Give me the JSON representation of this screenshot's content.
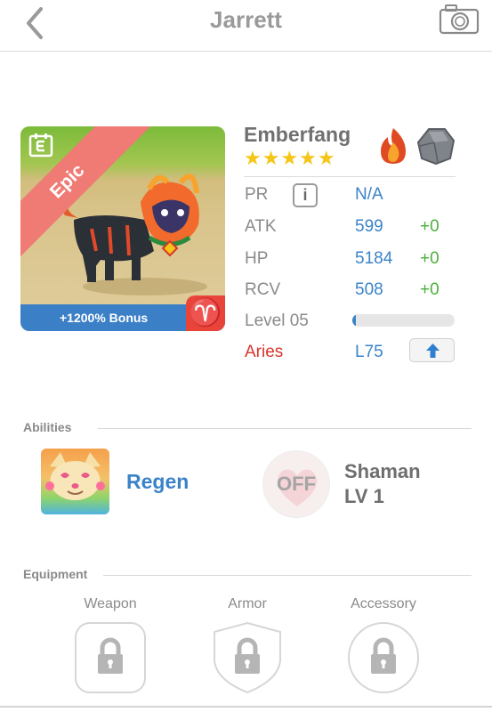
{
  "header": {
    "title": "Jarrett",
    "back_icon": "chevron-left-icon",
    "camera_icon": "camera-icon"
  },
  "card": {
    "rarity": "Epic",
    "bonus": "+1200% Bonus",
    "sign_glyph": "♈",
    "colors": {
      "rarity": "#f07a74",
      "bonus_bar": "#3b7fc7",
      "sign_badge": "#e8443a"
    }
  },
  "monster": {
    "name": "Emberfang",
    "stars": "★★★★★",
    "star_count": 5,
    "elements": [
      "fire-element-icon",
      "rock-element-icon"
    ]
  },
  "stats": {
    "pr": {
      "label": "PR",
      "value": "N/A"
    },
    "atk": {
      "label": "ATK",
      "value": "599",
      "bonus": "+0"
    },
    "hp": {
      "label": "HP",
      "value": "5184",
      "bonus": "+0"
    },
    "rcv": {
      "label": "RCV",
      "value": "508",
      "bonus": "+0"
    },
    "level": {
      "label": "Level 05",
      "progress": 0.02
    },
    "sign": {
      "label": "Aries",
      "value": "L75"
    }
  },
  "abilities": {
    "title": "Abilities",
    "ability": {
      "name": "Regen"
    },
    "skill": {
      "toggle": "OFF",
      "name_line1": "Shaman",
      "name_line2": "LV 1"
    }
  },
  "equipment": {
    "title": "Equipment",
    "slots": [
      {
        "label": "Weapon"
      },
      {
        "label": "Armor"
      },
      {
        "label": "Accessory"
      }
    ]
  }
}
